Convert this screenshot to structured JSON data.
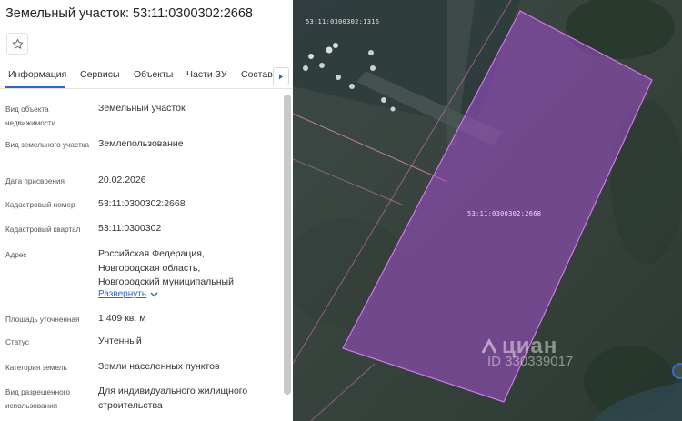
{
  "header": {
    "title": "Земельный участок: 53:11:0300302:2668"
  },
  "tabs": [
    "Информация",
    "Сервисы",
    "Объекты",
    "Части ЗУ",
    "Состав"
  ],
  "fields": [
    {
      "label": "Вид объекта недвижимости",
      "value": "Земельный участок"
    },
    {
      "label": "Вид земельного участка",
      "value": "Землепользование"
    },
    {
      "label": "Дата присвоения",
      "value": "20.02.2026"
    },
    {
      "label": "Кадастровый номер",
      "value": "53:11:0300302:2668"
    },
    {
      "label": "Кадастровый квартал",
      "value": "53:11:0300302"
    },
    {
      "label": "Адрес",
      "value_lines": [
        "Российская Федерация,",
        "Новгородская область,",
        "Новгородский муниципальный"
      ]
    },
    {
      "label": "Площадь уточненная",
      "value": "1 409 кв. м"
    },
    {
      "label": "Статус",
      "value": "Учтенный"
    },
    {
      "label": "Категория земель",
      "value": "Земли населенных пунктов"
    },
    {
      "label": "Вид разрешенного использования",
      "value_lines": [
        "Для индивидуального жилищного",
        "строительства"
      ]
    }
  ],
  "expand_label": "Развернуть",
  "map": {
    "parcel_label_main": "53:11:0300302:2668",
    "parcel_label_top": "53:11:0300302:1316",
    "watermark_brand": "циан",
    "watermark_id": "ID 330339017",
    "parcel_color": "#a24fd0"
  },
  "icons": {
    "favorite": "star-outline-icon",
    "tab_scroll": "chevron-right-icon",
    "expand": "chevron-down-icon",
    "compass": "compass-icon"
  }
}
